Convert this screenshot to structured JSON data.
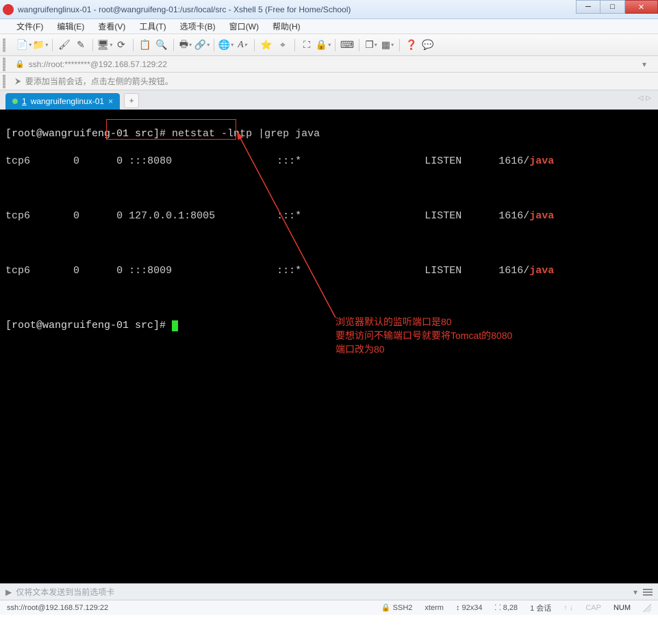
{
  "titlebar": {
    "title": "wangruifenglinux-01 - root@wangruifeng-01:/usr/local/src - Xshell 5 (Free for Home/School)"
  },
  "menubar": {
    "items": [
      "文件(F)",
      "编辑(E)",
      "查看(V)",
      "工具(T)",
      "选项卡(B)",
      "窗口(W)",
      "帮助(H)"
    ]
  },
  "addressbar": {
    "lock_icon": "🔒",
    "text": "ssh://root:********@192.168.57.129:22"
  },
  "tipbar": {
    "icon": "▸",
    "text": "要添加当前会话，点击左侧的箭头按钮。"
  },
  "tabs": {
    "active": {
      "index": "1",
      "label": "wangruifenglinux-01"
    },
    "add": "+"
  },
  "terminal": {
    "prompt1_a": "[root@wangruifeng-01 src]# ",
    "prompt1_b": "netstat -lntp |grep java",
    "row1": {
      "proto": "tcp6",
      "recv": "0",
      "send": "0",
      "local": ":::8080",
      "foreign": ":::*",
      "state": "LISTEN",
      "pid": "1616/",
      "prog": "java"
    },
    "row2": {
      "proto": "tcp6",
      "recv": "0",
      "send": "0",
      "local": "127.0.0.1:8005",
      "foreign": ":::*",
      "state": "LISTEN",
      "pid": "1616/",
      "prog": "java"
    },
    "row3": {
      "proto": "tcp6",
      "recv": "0",
      "send": "0",
      "local": ":::8009",
      "foreign": ":::*",
      "state": "LISTEN",
      "pid": "1616/",
      "prog": "java"
    },
    "prompt2": "[root@wangruifeng-01 src]# ",
    "annotation": "浏览器默认的监听端口是80\n要想访问不输端口号就要将Tomcat的8080\n端口改为80"
  },
  "inputbar": {
    "placeholder": "仅将文本发送到当前选项卡"
  },
  "statusbar": {
    "conn": "ssh://root@192.168.57.129:22",
    "ssh": "SSH2",
    "term": "xterm",
    "size": "92x34",
    "pos": "8,28",
    "sessions": "1 会话",
    "cap": "CAP",
    "num": "NUM"
  },
  "icons": {
    "new_doc": "📄",
    "folder": "📁",
    "brush": "🖌",
    "wand": "✎",
    "screen": "🖥",
    "refresh": "⟳",
    "copy": "📋",
    "search": "🔍",
    "print": "🖶",
    "link": "🔗",
    "globe": "🌐",
    "font": "A",
    "star": "⭐",
    "compass": "⌖",
    "expand": "⛶",
    "lock2": "🔒",
    "keyboard": "⌨",
    "window": "❐",
    "grid": "▦",
    "help": "❓",
    "chat": "💬"
  }
}
